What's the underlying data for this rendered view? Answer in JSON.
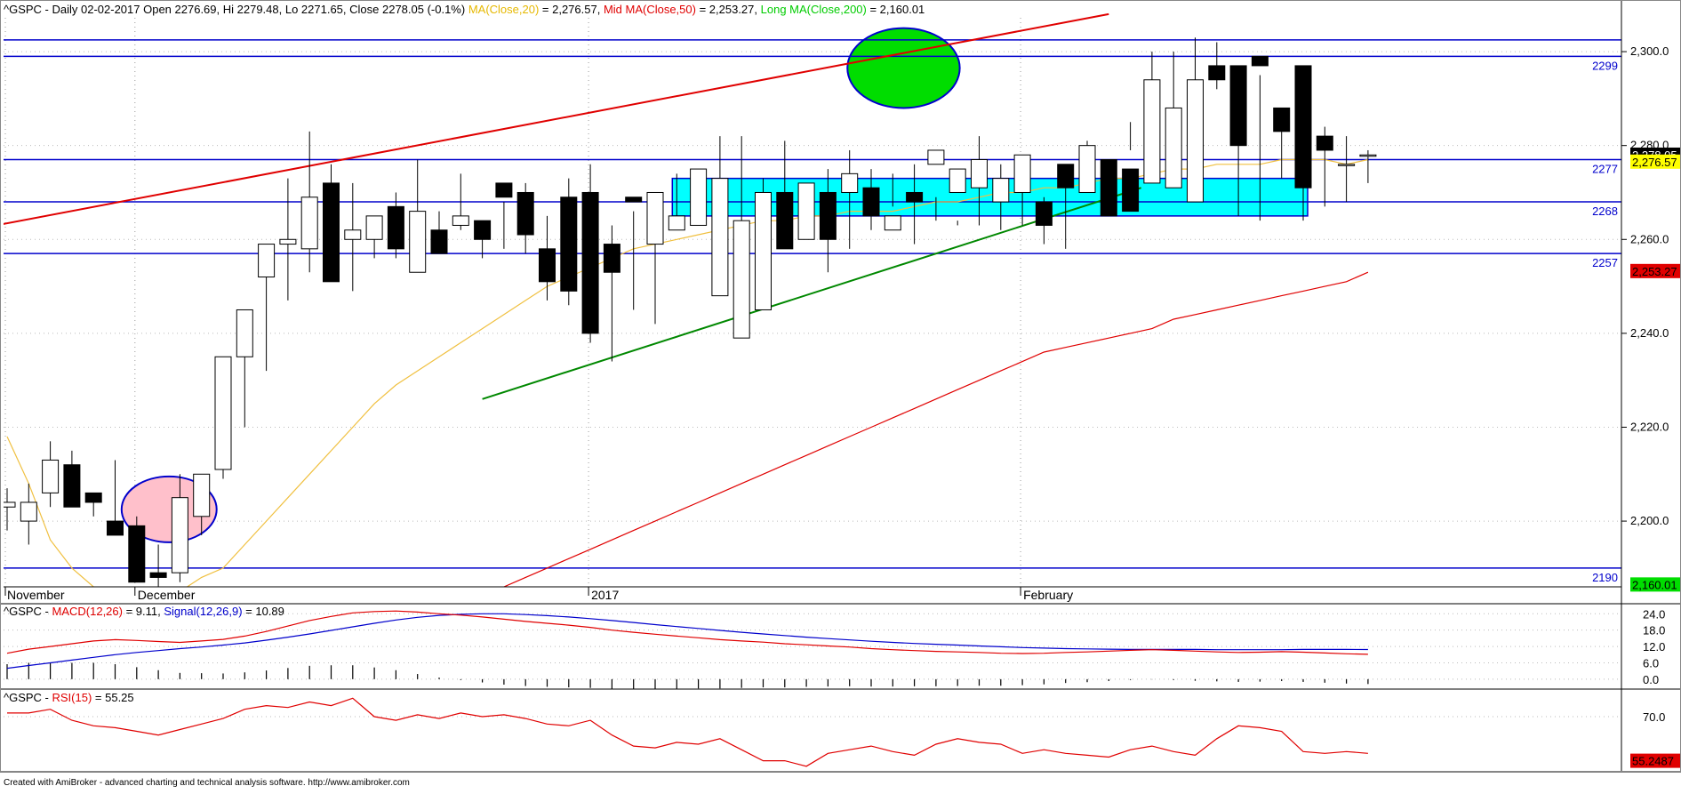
{
  "header": {
    "main": [
      {
        "text": "^GSPC - Daily 02-02-2017 Open 2276.69, Hi 2279.48, Lo 2271.65, Close 2278.05 (-0.1%) ",
        "color": "#000000"
      },
      {
        "text": "MA(Close,20)",
        "color": "#e6b800"
      },
      {
        "text": " = 2,276.57, ",
        "color": "#000000"
      },
      {
        "text": "Mid MA(Close,50)",
        "color": "#e00000"
      },
      {
        "text": " = 2,253.27, ",
        "color": "#000000"
      },
      {
        "text": "Long MA(Close,200)",
        "color": "#00cc00"
      },
      {
        "text": " = 2,160.01",
        "color": "#000000"
      }
    ],
    "macd": [
      {
        "text": "^GSPC - ",
        "color": "#000000"
      },
      {
        "text": "MACD(12,26)",
        "color": "#e00000"
      },
      {
        "text": " = 9.11, ",
        "color": "#000000"
      },
      {
        "text": "Signal(12,26,9)",
        "color": "#0000cc"
      },
      {
        "text": " = 10.89",
        "color": "#000000"
      }
    ],
    "rsi": [
      {
        "text": "^GSPC - ",
        "color": "#000000"
      },
      {
        "text": "RSI(15)",
        "color": "#e00000"
      },
      {
        "text": " = 55.25",
        "color": "#000000"
      }
    ]
  },
  "footer": "Created with AmiBroker - advanced charting and technical analysis software. http://www.amibroker.com",
  "chart_data": {
    "type": "candlestick",
    "symbol": "^GSPC",
    "interval": "Daily",
    "dates": [
      "2016-11-01",
      "2016-11-02",
      "2016-11-03",
      "2016-11-04",
      "2016-11-07",
      "2016-11-08",
      "2016-11-09",
      "2016-11-10",
      "2016-11-11",
      "2016-11-14",
      "2016-11-15",
      "2016-11-16",
      "2016-11-17",
      "2016-11-18",
      "2016-11-21",
      "2016-11-22",
      "2016-11-23",
      "2016-11-25",
      "2016-11-28",
      "2016-11-29",
      "2016-11-30",
      "2016-12-01",
      "2016-12-02",
      "2016-12-05",
      "2016-12-06",
      "2016-12-07",
      "2016-12-08",
      "2016-12-09",
      "2016-12-12",
      "2016-12-13",
      "2016-12-14",
      "2016-12-15",
      "2016-12-16",
      "2016-12-19",
      "2016-12-20",
      "2016-12-21",
      "2016-12-22",
      "2016-12-23",
      "2016-12-27",
      "2016-12-28",
      "2016-12-29",
      "2016-12-30",
      "2017-01-03",
      "2017-01-04",
      "2017-01-05",
      "2017-01-06",
      "2017-01-09",
      "2017-01-10",
      "2017-01-11",
      "2017-01-12",
      "2017-01-13",
      "2017-01-17",
      "2017-01-18",
      "2017-01-19",
      "2017-01-20",
      "2017-01-23",
      "2017-01-24",
      "2017-01-25",
      "2017-01-26",
      "2017-01-27",
      "2017-01-30",
      "2017-01-31",
      "2017-02-01",
      "2017-02-02"
    ],
    "open": [
      2203,
      2200,
      2206,
      2212,
      2206,
      2200,
      2199,
      2189,
      2189,
      2201,
      2211,
      2235,
      2252,
      2259,
      2258,
      2272,
      2260,
      2260,
      2267,
      2253,
      2262,
      2263,
      2264,
      2272,
      2270,
      2258,
      2269,
      2270,
      2259,
      2269,
      2259,
      2262,
      2263,
      2248,
      2239,
      2245,
      2270,
      2260,
      2270,
      2270,
      2271,
      2262,
      2270,
      2276,
      2270,
      2271,
      2268,
      2270,
      2268,
      2276,
      2270,
      2277,
      2275,
      2272,
      2271,
      2268,
      2297,
      2297,
      2299,
      2288,
      2297,
      2282,
      2276,
      2278
    ],
    "high": [
      2207,
      2208,
      2217,
      2215,
      2205,
      2213,
      2201,
      2195,
      2210,
      2208,
      2213,
      2240,
      2252,
      2273,
      2283,
      2276,
      2272,
      2264,
      2270,
      2277,
      2266,
      2274,
      2264,
      2268,
      2272,
      2265,
      2273,
      2276,
      2263,
      2266,
      2268,
      2274,
      2273,
      2282,
      2282,
      2273,
      2281,
      2264,
      2275,
      2279,
      2275,
      2274,
      2276,
      2269,
      2264,
      2282,
      2276,
      2278,
      2269,
      2274,
      2281,
      2274,
      2285,
      2300,
      2300,
      2303,
      2302,
      2290,
      2295,
      2287,
      2281,
      2284,
      2282,
      2279
    ],
    "low": [
      2198,
      2195,
      2203,
      2203,
      2201,
      2197,
      2188,
      2185,
      2187,
      2197,
      2209,
      2220,
      2232,
      2247,
      2253,
      2256,
      2249,
      2256,
      2256,
      2254,
      2258,
      2262,
      2256,
      2258,
      2257,
      2247,
      2246,
      2238,
      2234,
      2245,
      2242,
      2264,
      2263,
      2259,
      2258,
      2261,
      2266,
      2262,
      2253,
      2258,
      2262,
      2267,
      2259,
      2264,
      2263,
      2263,
      2262,
      2263,
      2259,
      2258,
      2275,
      2268,
      2279,
      2285,
      2285,
      2293,
      2292,
      2265,
      2264,
      2273,
      2264,
      2267,
      2268,
      2272
    ],
    "close": [
      2204,
      2204,
      2213,
      2203,
      2204,
      2197,
      2187,
      2188,
      2205,
      2210,
      2235,
      2245,
      2259,
      2260,
      2269,
      2251,
      2262,
      2265,
      2258,
      2266,
      2257,
      2265,
      2260,
      2269,
      2261,
      2251,
      2249,
      2240,
      2253,
      2268,
      2270,
      2265,
      2275,
      2273,
      2264,
      2270,
      2258,
      2272,
      2260,
      2274,
      2265,
      2265,
      2268,
      2279,
      2275,
      2277,
      2273,
      2278,
      2263,
      2271,
      2280,
      2265,
      2266,
      2294,
      2288,
      2294,
      2294,
      2280,
      2297,
      2283,
      2271,
      2279,
      2276,
      2278
    ],
    "ma20": [
      2218,
      2208,
      2196,
      2190,
      2186,
      2183,
      2183,
      2184,
      2185,
      2188,
      2190,
      2195,
      2200,
      2205,
      2210,
      2215,
      2220,
      2225,
      2229,
      2232,
      2235,
      2238,
      2241,
      2244,
      2247,
      2250,
      2252,
      2254,
      2256,
      2258,
      2259,
      2260,
      2261,
      2262,
      2263,
      2264,
      2264,
      2265,
      2265,
      2266,
      2266,
      2266,
      2267,
      2268,
      2268,
      2269,
      2270,
      2270,
      2271,
      2271,
      2272,
      2273,
      2273,
      2274,
      2275,
      2275,
      2276,
      2276,
      2276,
      2277,
      2277,
      2277,
      2276,
      2277
    ],
    "ma50": [
      2150,
      2150,
      2150,
      2150,
      2150,
      2150,
      2150,
      2150,
      2150,
      2150,
      2150,
      2150,
      2150,
      2150,
      2150,
      2150,
      2150,
      2150,
      2150,
      2150,
      2150,
      2150,
      2184,
      2186,
      2188,
      2190,
      2192,
      2194,
      2196,
      2198,
      2200,
      2202,
      2204,
      2206,
      2208,
      2210,
      2212,
      2214,
      2216,
      2218,
      2220,
      2222,
      2224,
      2226,
      2228,
      2230,
      2232,
      2234,
      2236,
      2237,
      2238,
      2239,
      2240,
      2241,
      2243,
      2244,
      2245,
      2246,
      2247,
      2248,
      2249,
      2250,
      2251,
      2253
    ],
    "ma200_segment": {
      "start_index": 62,
      "end_index": 64,
      "values": [
        2157,
        2160.01
      ]
    },
    "y_ticks": [
      2200,
      2220,
      2240,
      2260,
      2280,
      2300
    ],
    "y_tick_labels": [
      "2,200.0",
      "2,220.0",
      "2,240.0",
      "2,260.0",
      "2,280.0",
      "2,300.0"
    ],
    "ylim": [
      2186,
      2311
    ],
    "x_labels": [
      {
        "text": "November",
        "index": 0
      },
      {
        "text": "December",
        "index": 6
      },
      {
        "text": "2017",
        "index": 27
      },
      {
        "text": "February",
        "index": 47
      }
    ],
    "last_value_labels": [
      {
        "text": "2,278.05",
        "value": 2278.05,
        "bg": "#000000",
        "fg": "#ffffff"
      },
      {
        "text": "2,276.57",
        "value": 2276.57,
        "bg": "#ffff00",
        "fg": "#000000"
      },
      {
        "text": "2,253.27",
        "value": 2253.27,
        "bg": "#e00000",
        "fg": "#000000"
      },
      {
        "text": "2,160.01",
        "value": 2186.5,
        "bg": "#00dd00",
        "fg": "#000000"
      }
    ],
    "horizontal_levels": [
      {
        "value": 2302.5,
        "label": ""
      },
      {
        "value": 2299,
        "label": "2299"
      },
      {
        "value": 2277,
        "label": "2277"
      },
      {
        "value": 2268,
        "label": "2268"
      },
      {
        "value": 2257,
        "label": "2257"
      },
      {
        "value": 2190,
        "label": "2190"
      }
    ],
    "colors": {
      "candle_up": "#ffffff",
      "candle_down": "#000000",
      "levels": "#0000cc",
      "ma20": "#f0c040",
      "ma50": "#e00000",
      "ma200": "#e00000",
      "resistance": "#e00000",
      "support": "#008800",
      "zone_fill": "#00ffff",
      "green_ellipse": "#00dd00",
      "pink_ellipse": "#ffc0cb"
    },
    "macd": {
      "y_ticks": [
        0,
        6,
        12,
        18,
        24
      ],
      "y_tick_labels": [
        "0.0",
        "6.0",
        "12.0",
        "18.0",
        "24.0"
      ],
      "ylim": [
        -2,
        28
      ],
      "macd": [
        9.5,
        11,
        12,
        13,
        14,
        14.5,
        14.2,
        13.8,
        13.5,
        14,
        14.6,
        15.8,
        17.5,
        19.5,
        21.5,
        23,
        24.3,
        24.8,
        25,
        24.6,
        24,
        23.5,
        22.8,
        22,
        21.2,
        20.5,
        19.8,
        19,
        18,
        17.2,
        16.5,
        15.8,
        15.2,
        14.5,
        14,
        13.6,
        13,
        12.6,
        12.2,
        11.8,
        11.2,
        10.8,
        10.5,
        10.2,
        10,
        9.8,
        9.5,
        9.4,
        9.5,
        9.8,
        10,
        10.3,
        10.6,
        10.8,
        10.6,
        10.3,
        10,
        9.8,
        9.9,
        10.1,
        9.9,
        9.6,
        9.3,
        9.11
      ],
      "signal": [
        4,
        5,
        6,
        7,
        8,
        9,
        9.8,
        10.5,
        11.2,
        11.8,
        12.5,
        13.3,
        14.3,
        15.4,
        16.6,
        17.9,
        19.2,
        20.5,
        21.7,
        22.7,
        23.4,
        23.8,
        24,
        24,
        23.7,
        23.3,
        22.8,
        22.2,
        21.5,
        20.8,
        20,
        19.3,
        18.6,
        17.9,
        17.2,
        16.6,
        16,
        15.4,
        14.9,
        14.4,
        13.9,
        13.5,
        13.1,
        12.8,
        12.5,
        12.2,
        11.9,
        11.6,
        11.4,
        11.2,
        11.1,
        11,
        10.9,
        10.9,
        10.9,
        10.9,
        10.8,
        10.8,
        10.8,
        10.8,
        10.9,
        10.9,
        10.9,
        10.89
      ],
      "histogram": [
        5.5,
        6,
        6,
        6,
        6,
        5.5,
        4.4,
        3.3,
        2.3,
        2.2,
        2.1,
        2.5,
        3.2,
        4.1,
        4.9,
        5.1,
        5.1,
        4.3,
        3.3,
        1.9,
        0.6,
        -0.3,
        -1.2,
        -2,
        -2.5,
        -2.8,
        -3,
        -3.2,
        -3.5,
        -3.6,
        -3.5,
        -3.5,
        -3.4,
        -3.4,
        -3.2,
        -3,
        -3,
        -2.8,
        -2.7,
        -2.6,
        -2.7,
        -2.7,
        -2.6,
        -2.6,
        -2.5,
        -2.4,
        -2.4,
        -2.2,
        -1.9,
        -1.4,
        -1.1,
        -0.7,
        -0.3,
        -0.1,
        -0.3,
        -0.6,
        -0.8,
        -1,
        -0.9,
        -0.7,
        -1,
        -1.3,
        -1.6,
        -1.78
      ]
    },
    "rsi": {
      "y_ticks": [
        70
      ],
      "y_tick_labels": [
        "70.0"
      ],
      "ylim": [
        40,
        85
      ],
      "values": [
        72,
        72,
        74,
        68,
        65,
        64,
        62,
        60,
        63,
        66,
        69,
        74,
        76,
        75,
        78,
        76,
        80,
        70,
        68,
        71,
        69,
        72,
        70,
        71,
        69,
        66,
        65,
        68,
        60,
        54,
        53,
        56,
        55,
        58,
        52,
        46,
        46,
        43,
        50,
        52,
        54,
        51,
        49,
        55,
        58,
        56,
        55,
        50,
        52,
        50,
        49,
        48,
        52,
        54,
        51,
        49,
        58,
        65,
        64,
        62,
        51,
        50,
        51,
        50
      ],
      "last_label": {
        "text": "55.2487",
        "value": 46,
        "bg": "#e00000",
        "fg": "#000000"
      }
    },
    "annotations": {
      "resistance_line": {
        "from": [
          -0.5,
          2263
        ],
        "to": [
          51,
          2308
        ]
      },
      "support_line": {
        "from": [
          22,
          2226
        ],
        "to": [
          52.5,
          2271
        ]
      },
      "zone": {
        "from_index": 31,
        "to_index": 60,
        "top": 2273,
        "bottom": 2265
      },
      "green_ellipse": {
        "center_index": 41.5,
        "center_value": 2296.5,
        "rx_bars": 2.6,
        "ry_value": 8.5
      },
      "pink_ellipse": {
        "center_index": 7.5,
        "center_value": 2202.5,
        "rx_bars": 2.2,
        "ry_value": 7
      }
    }
  }
}
